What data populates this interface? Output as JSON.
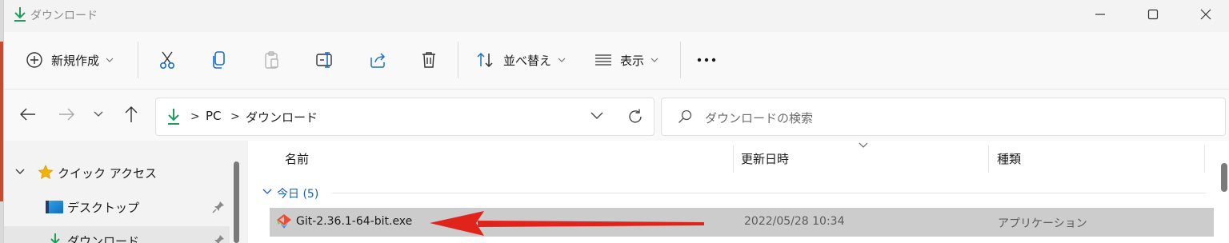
{
  "window": {
    "title": "ダウンロード",
    "icon": "download-arrow-icon"
  },
  "toolbar": {
    "new_label": "新規作成",
    "sort_label": "並べ替え",
    "view_label": "表示",
    "icons": [
      "add-circle-icon",
      "cut-icon",
      "copy-icon",
      "paste-icon",
      "rename-icon",
      "share-icon",
      "delete-icon",
      "sort-icon",
      "view-list-icon",
      "more-icon"
    ]
  },
  "address": {
    "crumbs": [
      "PC",
      "ダウンロード"
    ],
    "separator": ">"
  },
  "search": {
    "placeholder": "ダウンロードの検索"
  },
  "nav_pane": {
    "items": [
      {
        "label": "クイック アクセス",
        "icon": "star-icon",
        "expanded": true
      },
      {
        "label": "デスクトップ",
        "icon": "desktop-icon",
        "pinned": true
      },
      {
        "label": "ダウンロード",
        "icon": "download-arrow-icon",
        "pinned": true,
        "selected": true
      }
    ]
  },
  "file_pane": {
    "columns": [
      "名前",
      "更新日時",
      "種類"
    ],
    "group": {
      "label": "今日 (5)"
    },
    "files": [
      {
        "name": "Git-2.36.1-64-bit.exe",
        "modified": "2022/05/28 10:34",
        "type": "アプリケーション",
        "icon": "git-installer-icon"
      }
    ]
  },
  "colors": {
    "accent_green": "#1e9e5a",
    "annotation_red": "#e0231b",
    "selection": "#cccccc",
    "group_blue": "#1a5fb4"
  }
}
